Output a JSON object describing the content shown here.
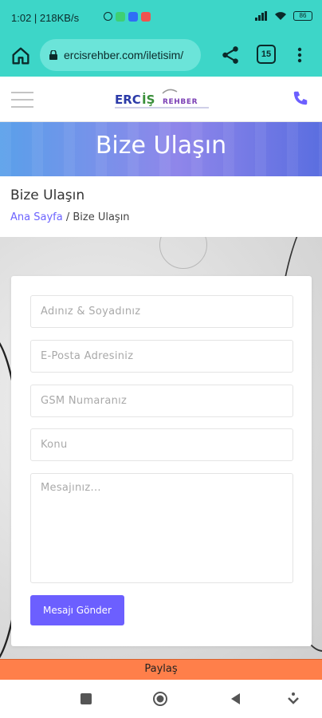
{
  "status_bar": {
    "time": "1:02",
    "speed": "218KB/s",
    "battery": "86",
    "app_colors": [
      "#3ecf73",
      "#2f6df6",
      "#ef5350"
    ]
  },
  "browser": {
    "url": "ercisrehber.com/iletisim/",
    "tab_count": "15"
  },
  "site": {
    "logo_text": "ERCİŞREHBER",
    "accent": "#6c63ff"
  },
  "hero": {
    "title": "Bize Ulaşın"
  },
  "page": {
    "title": "Bize Ulaşın",
    "breadcrumb_home": "Ana Sayfa",
    "breadcrumb_sep": " / ",
    "breadcrumb_current": "Bize Ulaşın"
  },
  "form": {
    "name_placeholder": "Adınız & Soyadınız",
    "email_placeholder": "E-Posta Adresiniz",
    "phone_placeholder": "GSM Numaranız",
    "subject_placeholder": "Konu",
    "message_placeholder": "Mesajınız...",
    "submit_label": "Mesajı Gönder"
  },
  "share_bar": {
    "label": "Paylaş"
  }
}
